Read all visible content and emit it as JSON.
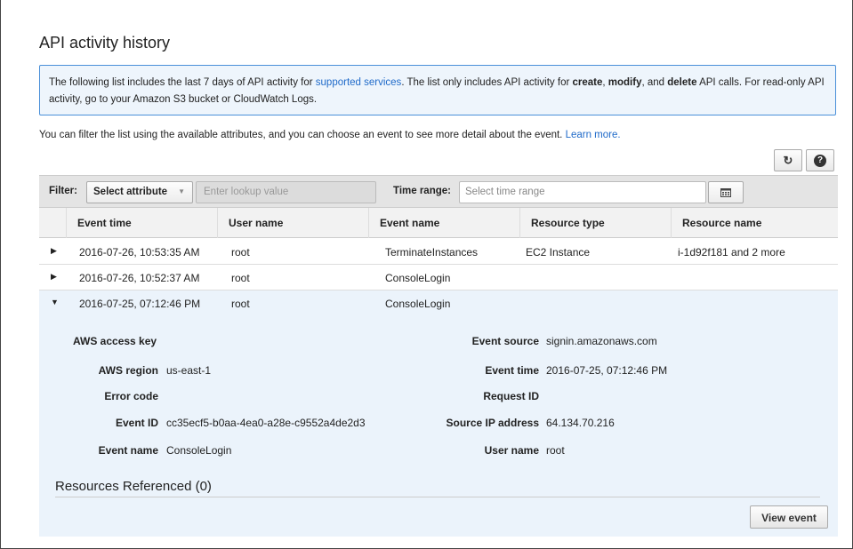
{
  "page": {
    "title": "API activity history"
  },
  "info": {
    "text1": "The following list includes the last 7 days of API activity for ",
    "link": "supported services",
    "text2": ". The list only includes API activity for ",
    "create": "create",
    "comma1": ", ",
    "modify": "modify",
    "text3": ", and ",
    "delete": "delete",
    "text4": " API calls. For read-only API activity, go to your Amazon S3 bucket or CloudWatch Logs."
  },
  "filter_help": {
    "text": "You can filter the list using the available attributes, and you can choose an event to see more detail about the event. ",
    "link": "Learn more."
  },
  "toolbar": {
    "refresh_icon": "refresh-icon",
    "refresh_glyph": "↻",
    "help_icon": "help-icon",
    "help_glyph": "?"
  },
  "filter": {
    "label": "Filter:",
    "select_value": "Select attribute",
    "lookup_placeholder": "Enter lookup value",
    "time_label": "Time range:",
    "time_placeholder": "Select time range",
    "calendar_icon": "calendar-icon"
  },
  "table": {
    "columns": [
      "Event time",
      "User name",
      "Event name",
      "Resource type",
      "Resource name"
    ],
    "rows": [
      {
        "time": "2016-07-26, 10:53:35 AM",
        "user": "root",
        "event": "TerminateInstances",
        "rtype": "EC2 Instance",
        "rname": "i-1d92f181 and 2 more"
      },
      {
        "time": "2016-07-26, 10:52:37 AM",
        "user": "root",
        "event": "ConsoleLogin",
        "rtype": "",
        "rname": ""
      },
      {
        "time": "2016-07-25, 07:12:46 PM",
        "user": "root",
        "event": "ConsoleLogin",
        "rtype": "",
        "rname": ""
      }
    ]
  },
  "detail": {
    "access_key_label": "AWS access key",
    "access_key_value": "",
    "region_label": "AWS region",
    "region_value": "us-east-1",
    "error_label": "Error code",
    "error_value": "",
    "event_id_label": "Event ID",
    "event_id_value": "cc35ecf5-b0aa-4ea0-a28e-c9552a4de2d3",
    "event_name_label": "Event name",
    "event_name_value": "ConsoleLogin",
    "source_label": "Event source",
    "source_value": "signin.amazonaws.com",
    "time_label": "Event time",
    "time_value": "2016-07-25, 07:12:46 PM",
    "request_label": "Request ID",
    "request_value": "",
    "ip_label": "Source IP address",
    "ip_value": "64.134.70.216",
    "user_label": "User name",
    "user_value": "root",
    "resources_title": "Resources Referenced (0)",
    "view_button": "View event"
  },
  "colors": {
    "link": "#1f6ac9",
    "info_border": "#4a90d9",
    "info_bg": "#eef5fc",
    "expanded_bg": "#ebf3fb"
  }
}
